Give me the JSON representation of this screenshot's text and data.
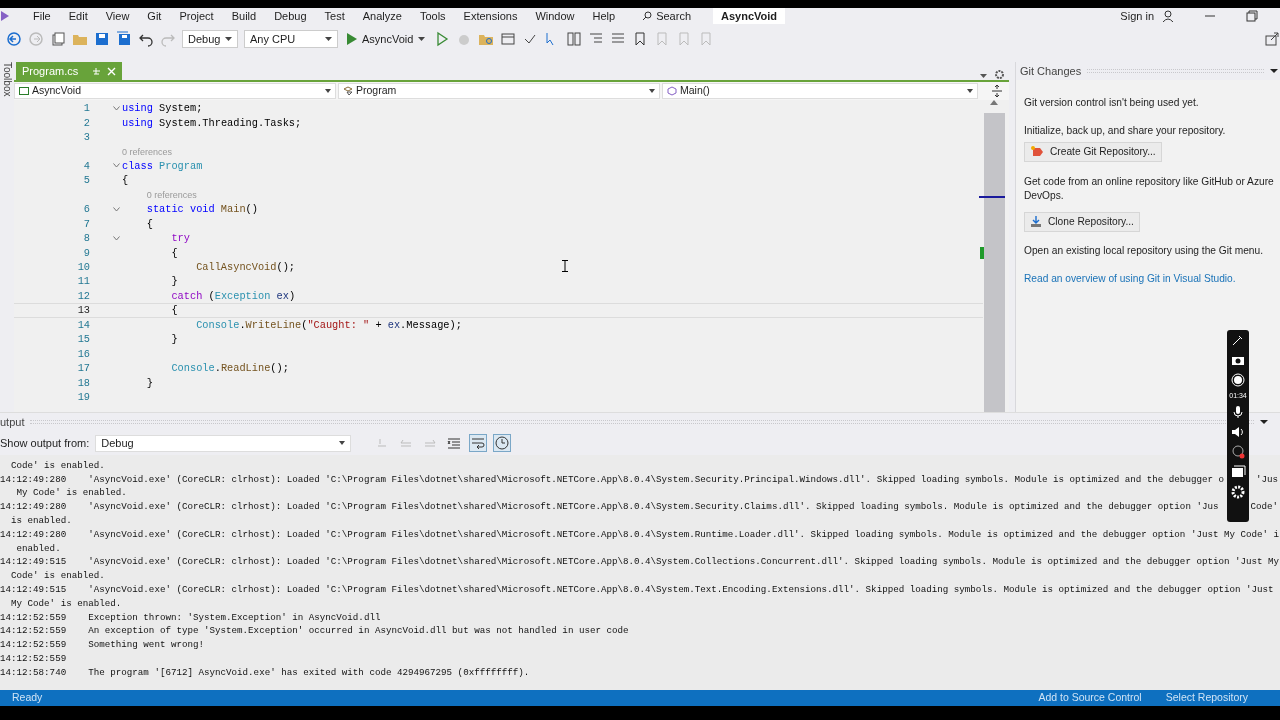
{
  "menu": {
    "items": [
      "File",
      "Edit",
      "View",
      "Git",
      "Project",
      "Build",
      "Debug",
      "Test",
      "Analyze",
      "Tools",
      "Extensions",
      "Window",
      "Help"
    ],
    "search": "Search",
    "title": "AsyncVoid",
    "sign_in": "Sign in"
  },
  "toolbar": {
    "configuration": "Debug",
    "platform": "Any CPU",
    "run_target": "AsyncVoid"
  },
  "toolbox": {
    "label": "Toolbox"
  },
  "editor": {
    "tab": {
      "label": "Program.cs",
      "selected": true
    },
    "nav": [
      "AsyncVoid",
      "Program",
      "Main()"
    ],
    "lines": [
      {
        "kind": "code",
        "number": "1",
        "fold": true,
        "current": false,
        "tokens": [
          {
            "kind": "kw",
            "text": "using"
          },
          {
            "kind": "plain",
            "text": " System;"
          }
        ]
      },
      {
        "kind": "code",
        "number": "2",
        "fold": false,
        "current": false,
        "tokens": [
          {
            "kind": "kw",
            "text": "using"
          },
          {
            "kind": "plain",
            "text": " System.Threading.Tasks;"
          }
        ]
      },
      {
        "kind": "code",
        "number": "3",
        "fold": false,
        "current": false
      },
      {
        "kind": "lens",
        "text": "0 references"
      },
      {
        "kind": "code",
        "number": "4",
        "fold": true,
        "current": false,
        "tokens": [
          {
            "kind": "kw",
            "text": "class"
          },
          {
            "kind": "type",
            "text": " Program"
          }
        ]
      },
      {
        "kind": "code",
        "number": "5",
        "fold": false,
        "current": false,
        "tokens": [
          {
            "kind": "plain",
            "text": "{"
          }
        ]
      },
      {
        "kind": "lens",
        "text": "0 references"
      },
      {
        "kind": "code",
        "number": "6",
        "fold": true,
        "current": false,
        "tokens": [
          {
            "kind": "kw",
            "text": "    static void"
          },
          {
            "kind": "method",
            "text": " Main"
          },
          {
            "kind": "plain",
            "text": "()"
          }
        ]
      },
      {
        "kind": "code",
        "number": "7",
        "fold": false,
        "current": false,
        "tokens": [
          {
            "kind": "plain",
            "text": "    {"
          }
        ]
      },
      {
        "kind": "code",
        "number": "8",
        "fold": true,
        "current": false,
        "tokens": [
          {
            "kind": "ctl",
            "text": "        try"
          }
        ]
      },
      {
        "kind": "code",
        "number": "9",
        "fold": false,
        "current": false,
        "tokens": [
          {
            "kind": "plain",
            "text": "        {"
          }
        ]
      },
      {
        "kind": "code",
        "number": "10",
        "fold": false,
        "current": false,
        "tokens": [
          {
            "kind": "method",
            "text": "            CallAsyncVoid"
          },
          {
            "kind": "plain",
            "text": "();"
          }
        ]
      },
      {
        "kind": "code",
        "number": "11",
        "fold": false,
        "current": false,
        "tokens": [
          {
            "kind": "plain",
            "text": "        }"
          }
        ]
      },
      {
        "kind": "code",
        "number": "12",
        "fold": false,
        "current": false,
        "tokens": [
          {
            "kind": "ctl",
            "text": "        catch"
          },
          {
            "kind": "plain",
            "text": " ("
          },
          {
            "kind": "type",
            "text": "Exception"
          },
          {
            "kind": "var",
            "text": " ex"
          },
          {
            "kind": "plain",
            "text": ")"
          }
        ]
      },
      {
        "kind": "code",
        "number": "13",
        "fold": false,
        "current": true,
        "tokens": [
          {
            "kind": "plain",
            "text": "        {"
          }
        ]
      },
      {
        "kind": "code",
        "number": "14",
        "fold": false,
        "current": false,
        "tokens": [
          {
            "kind": "type",
            "text": "            Console"
          },
          {
            "kind": "plain",
            "text": "."
          },
          {
            "kind": "method",
            "text": "WriteLine"
          },
          {
            "kind": "plain",
            "text": "("
          },
          {
            "kind": "str",
            "text": "\"Caught: \""
          },
          {
            "kind": "plain",
            "text": " + "
          },
          {
            "kind": "var",
            "text": "ex"
          },
          {
            "kind": "plain",
            "text": ".Message);"
          }
        ]
      },
      {
        "kind": "code",
        "number": "15",
        "fold": false,
        "current": false,
        "tokens": [
          {
            "kind": "plain",
            "text": "        }"
          }
        ]
      },
      {
        "kind": "code",
        "number": "16",
        "fold": false,
        "current": false
      },
      {
        "kind": "code",
        "number": "17",
        "fold": false,
        "current": false,
        "tokens": [
          {
            "kind": "type",
            "text": "        Console"
          },
          {
            "kind": "plain",
            "text": "."
          },
          {
            "kind": "method",
            "text": "ReadLine"
          },
          {
            "kind": "plain",
            "text": "();"
          }
        ]
      },
      {
        "kind": "code",
        "number": "18",
        "fold": false,
        "current": false,
        "tokens": [
          {
            "kind": "plain",
            "text": "    }"
          }
        ]
      },
      {
        "kind": "code",
        "number": "19",
        "fold": false,
        "current": false
      }
    ]
  },
  "git_changes": {
    "title": "Git Changes",
    "intro": "Git version control isn't being used yet.",
    "init_text": "Initialize, back up, and share your repository.",
    "create_button": "Create Git Repository...",
    "clone_text": "Get code from an online repository like GitHub or Azure DevOps.",
    "clone_button": "Clone Repository...",
    "open_text": "Open an existing local repository using the Git menu.",
    "link": "Read an overview of using Git in Visual Studio."
  },
  "output": {
    "title": "utput",
    "source_label": "Show output from:",
    "source": "Debug",
    "lines": [
      {
        "text": "  Code' is enabled."
      },
      {
        "text": "14:12:49:280    'AsyncVoid.exe' (CoreCLR: clrhost): Loaded 'C:\\Program Files\\dotnet\\shared\\Microsoft.NETCore.App\\8.0.4\\System.Security.Principal.Windows.dll'. Skipped loading symbols. Module is optimized and the debugger o",
        "tail": "'Jus"
      },
      {
        "text": "   My Code' is enabled."
      },
      {
        "text": "14:12:49:280    'AsyncVoid.exe' (CoreCLR: clrhost): Loaded 'C:\\Program Files\\dotnet\\shared\\Microsoft.NETCore.App\\8.0.4\\System.Security.Claims.dll'. Skipped loading symbols. Module is optimized and the debugger option 'Jus",
        "tail": "Code'"
      },
      {
        "text": "  is enabled."
      },
      {
        "text": "14:12:49:280    'AsyncVoid.exe' (CoreCLR: clrhost): Loaded 'C:\\Program Files\\dotnet\\shared\\Microsoft.NETCore.App\\8.0.4\\System.Runtime.Loader.dll'. Skipped loading symbols. Module is optimized and the debugger option 'Just My Code' i"
      },
      {
        "text": "   enabled."
      },
      {
        "text": "14:12:49:515    'AsyncVoid.exe' (CoreCLR: clrhost): Loaded 'C:\\Program Files\\dotnet\\shared\\Microsoft.NETCore.App\\8.0.4\\System.Collections.Concurrent.dll'. Skipped loading symbols. Module is optimized and the debugger option 'Just My"
      },
      {
        "text": "  Code' is enabled."
      },
      {
        "text": "14:12:49:515    'AsyncVoid.exe' (CoreCLR: clrhost): Loaded 'C:\\Program Files\\dotnet\\shared\\Microsoft.NETCore.App\\8.0.4\\System.Text.Encoding.Extensions.dll'. Skipped loading symbols. Module is optimized and the debugger option 'Just"
      },
      {
        "text": "  My Code' is enabled."
      },
      {
        "text": "14:12:52:559    Exception thrown: 'System.Exception' in AsyncVoid.dll"
      },
      {
        "text": "14:12:52:559    An exception of type 'System.Exception' occurred in AsyncVoid.dll but was not handled in user code"
      },
      {
        "text": "14:12:52:559    Something went wrong!"
      },
      {
        "text": "14:12:52:559"
      },
      {
        "text": "14:12:58:740    The program '[6712] AsyncVoid.exe' has exited with code 4294967295 (0xffffffff)."
      }
    ]
  },
  "recorder": {
    "time": "01:34"
  },
  "status_bar": {
    "state": "Ready",
    "source_control": "Add to Source Control",
    "repository": "Select Repository"
  }
}
